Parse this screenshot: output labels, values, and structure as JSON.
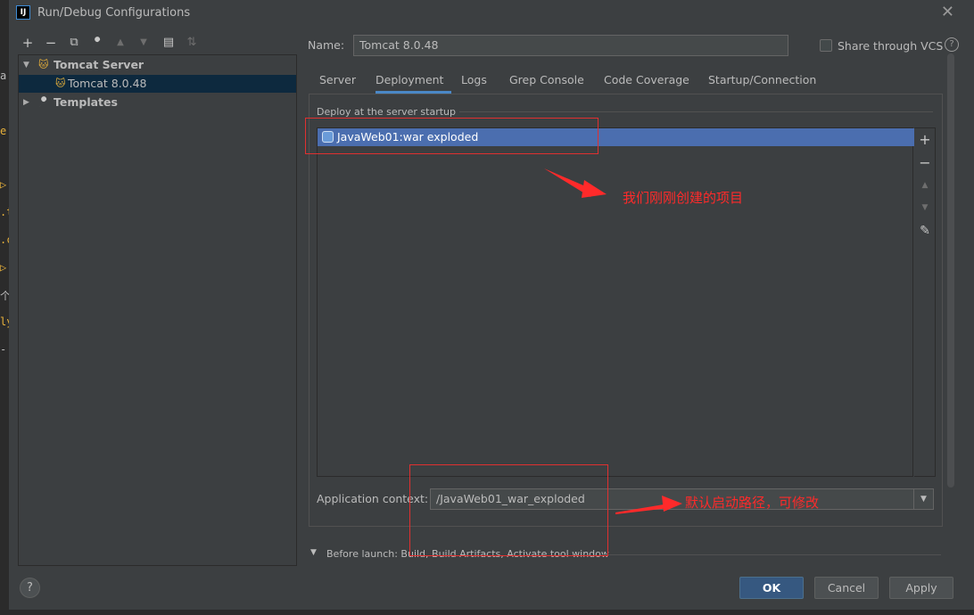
{
  "background_strip": {
    "glyphs": [
      "a",
      "e",
      "▷",
      ".t",
      ".c",
      "▷",
      "个",
      "ly",
      "-"
    ]
  },
  "window": {
    "title": "Run/Debug Configurations",
    "app_icon": "IJ",
    "close_icon": "close-icon"
  },
  "toolbar": {
    "items": [
      {
        "name": "add-icon",
        "glyph": "+"
      },
      {
        "name": "remove-icon",
        "glyph": "−"
      },
      {
        "name": "copy-icon",
        "glyph": "⧉"
      },
      {
        "name": "wrench-icon",
        "glyph": "🔧"
      },
      {
        "name": "move-up-icon",
        "glyph": "▲"
      },
      {
        "name": "move-down-icon",
        "glyph": "▼"
      },
      {
        "name": "folder-icon",
        "glyph": "▤"
      },
      {
        "name": "sort-icon",
        "glyph": "⇅"
      }
    ]
  },
  "tree": {
    "group_label": "Tomcat Server",
    "child_label": "Tomcat 8.0.48",
    "templates_label": "Templates"
  },
  "name_label": "Name:",
  "name_value": "Tomcat 8.0.48",
  "share_label": "Share through VCS",
  "help_glyph": "?",
  "tabs": [
    "Server",
    "Deployment",
    "Logs",
    "Grep Console",
    "Code Coverage",
    "Startup/Connection"
  ],
  "active_tab": "Deployment",
  "deploy_caption": "Deploy at the server startup",
  "deploy_items": [
    "JavaWeb01:war exploded"
  ],
  "side_tools": [
    "+",
    "−",
    "▲",
    "▼",
    "✎"
  ],
  "context_label": "Application context:",
  "context_value": "/JavaWeb01_war_exploded",
  "dropdown_glyph": "▼",
  "before_launch": "Before launch: Build, Build Artifacts, Activate tool window",
  "buttons": {
    "ok": "OK",
    "cancel": "Cancel",
    "apply": "Apply"
  },
  "annotations": {
    "project_note": "我们刚刚创建的项目",
    "path_note": "默认启动路径，可修改"
  },
  "colors": {
    "selection": "#4b6eaf",
    "tree_selection": "#0d293e",
    "annotation_red": "#ff2a2a",
    "ok_button": "#365880",
    "tomcat_icon": "#e8b13b"
  }
}
